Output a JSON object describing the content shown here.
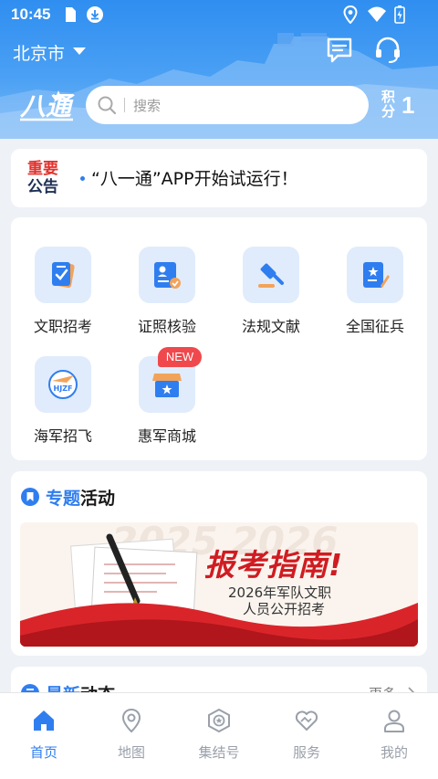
{
  "status_bar": {
    "time": "10:45"
  },
  "header": {
    "city": "北京市",
    "logo_text": "八一通",
    "search_placeholder": "搜索",
    "points_label": "积分",
    "points_value": "1",
    "accent_color": "#2f8ef0"
  },
  "notice": {
    "badge_top": "重要",
    "badge_bottom": "公告",
    "text": "“八一通”APP开始试运行！"
  },
  "services": [
    {
      "label": "文职招考",
      "icon": "exam-icon"
    },
    {
      "label": "证照核验",
      "icon": "id-verify-icon"
    },
    {
      "label": "法规文献",
      "icon": "gavel-icon"
    },
    {
      "label": "全国征兵",
      "icon": "enlist-icon"
    },
    {
      "label": "海军招飞",
      "icon": "navy-pilot-icon"
    },
    {
      "label": "惠军商城",
      "icon": "store-icon"
    }
  ],
  "new_badge": "NEW",
  "topic": {
    "title_blue": "专题",
    "title_rest": "活动",
    "banner": {
      "title": "报考指南!",
      "subtitle_line1": "2026年军队文职",
      "subtitle_line2": "人员公开招考"
    }
  },
  "news": {
    "title_blue": "最新",
    "title_rest": "动态",
    "more": "更多"
  },
  "bottom_nav": [
    {
      "label": "首页",
      "icon": "home-icon",
      "active": true
    },
    {
      "label": "地图",
      "icon": "map-pin-icon",
      "active": false
    },
    {
      "label": "集结号",
      "icon": "badge-icon",
      "active": false
    },
    {
      "label": "服务",
      "icon": "heart-hands-icon",
      "active": false
    },
    {
      "label": "我的",
      "icon": "person-icon",
      "active": false
    }
  ]
}
